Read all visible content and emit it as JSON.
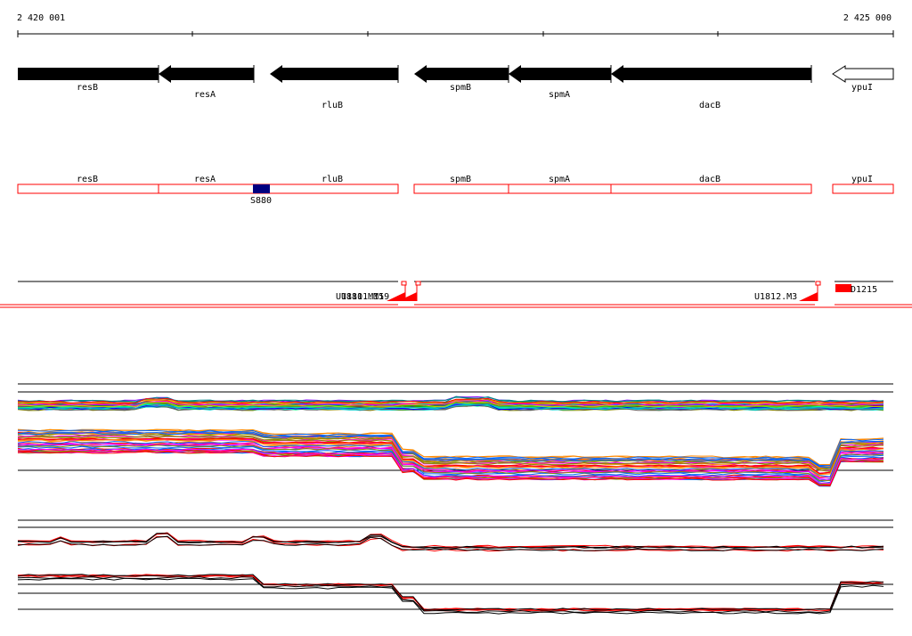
{
  "ruler": {
    "start_label": "2 420 001",
    "end_label": "2 425 000"
  },
  "genes": [
    {
      "name": "resB",
      "strand": "-",
      "style": "filled"
    },
    {
      "name": "resA",
      "strand": "-",
      "style": "filled"
    },
    {
      "name": "rluB",
      "strand": "-",
      "style": "filled"
    },
    {
      "name": "spmB",
      "strand": "-",
      "style": "filled"
    },
    {
      "name": "spmA",
      "strand": "-",
      "style": "filled"
    },
    {
      "name": "dacB",
      "strand": "-",
      "style": "filled"
    },
    {
      "name": "ypuI",
      "strand": "-",
      "style": "outline"
    }
  ],
  "transcripts": [
    {
      "name": "resB"
    },
    {
      "name": "resA"
    },
    {
      "name": "rluB"
    },
    {
      "name": "spmB"
    },
    {
      "name": "spmA"
    },
    {
      "name": "dacB"
    },
    {
      "name": "ypuI"
    }
  ],
  "features": {
    "s_label": "S880"
  },
  "upshift_labels": {
    "left": "U1811.M19",
    "left_overlap": "U1810.M15",
    "right": "U1812.M3",
    "far_right": "D1215"
  },
  "colors": {
    "gene_fill": "#000000",
    "transcript_outline": "#ff0000",
    "feature_block": "#000080",
    "marker": "#ff0000"
  }
}
